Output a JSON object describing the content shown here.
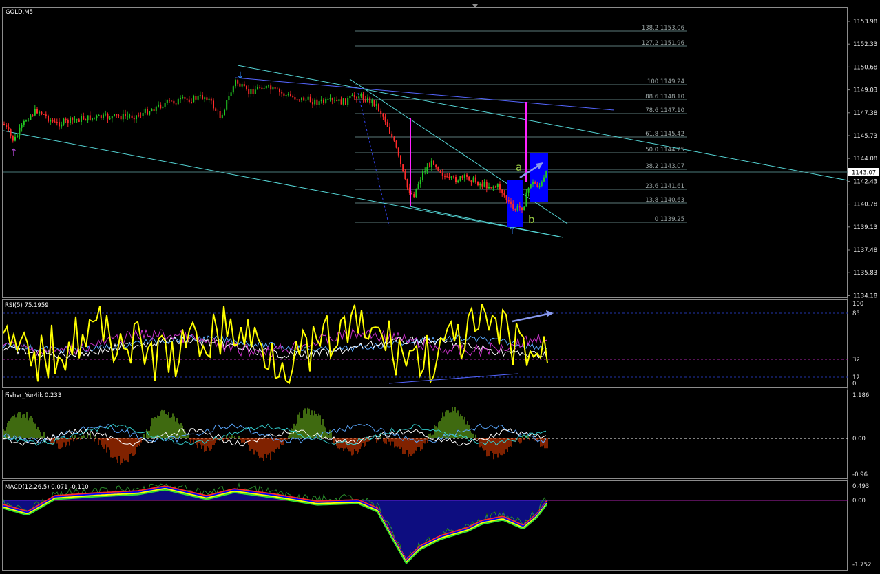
{
  "main": {
    "title": "GOLD,M5",
    "price_axis": [
      "1153.98",
      "1152.33",
      "1150.68",
      "1149.03",
      "1147.38",
      "1145.73",
      "1144.08",
      "1142.43",
      "1140.78",
      "1139.13",
      "1137.48",
      "1135.83",
      "1134.18"
    ],
    "current_price": "1143.07",
    "fib_levels": [
      "138.2 1153.06",
      "127.2 1151.96",
      "100 1149.24",
      "88.6 1148.10",
      "78.6 1147.10",
      "61.8 1145.42",
      "50.0 1144.25",
      "38.2 1143.07",
      "23.6 1141.61",
      "13.8 1140.63",
      "0 1139.25"
    ],
    "annotations": {
      "a": "a",
      "b": "b"
    }
  },
  "rsi": {
    "title": "RSI(5) 75.1959",
    "levels": [
      "100",
      "85",
      "32",
      "12",
      "0"
    ]
  },
  "fisher": {
    "title": "Fisher_Yur4ik 0.233",
    "levels": [
      "1.186",
      "0.00",
      "-0.96"
    ]
  },
  "macd": {
    "title": "MACD(12,26,5) 0.071 -0.110",
    "levels": [
      "0.493",
      "0.00",
      "-1.752"
    ]
  },
  "colors": {
    "bull": "#22c822",
    "bear": "#ff2a2a",
    "rsi": "#ffff00",
    "fisher_pos": "#7ed321",
    "fisher_neg": "#ff4400",
    "macd_hist": "#1a1aff",
    "channel": "#55d6d6",
    "magenta": "#ff22ff",
    "zone": "#0000ff"
  }
}
